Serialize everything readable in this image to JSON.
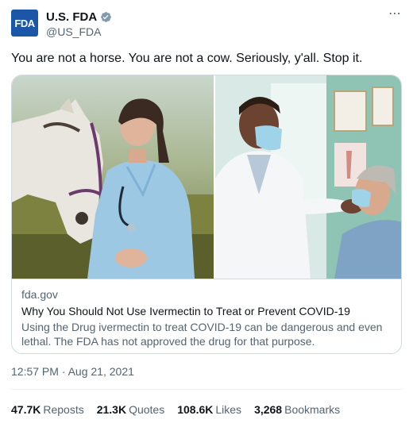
{
  "author": {
    "avatar_text": "FDA",
    "display_name": "U.S. FDA",
    "handle": "@US_FDA",
    "verified_icon": "verified-badge-icon",
    "avatar_color": "#1b57a6"
  },
  "more_icon": "⋯",
  "tweet": {
    "text": "You are not a horse. You are not a cow. Seriously, y'all. Stop it."
  },
  "card": {
    "domain": "fda.gov",
    "title": "Why You Should Not Use Ivermectin to Treat or Prevent COVID-19",
    "description": "Using the Drug ivermectin to treat COVID-19 can be dangerous and even lethal. The FDA has not approved the drug for that purpose."
  },
  "timestamp": "12:57 PM · Aug 21, 2021",
  "stats": {
    "reposts_value": "47.7K",
    "reposts_label": "Reposts",
    "quotes_value": "21.3K",
    "quotes_label": "Quotes",
    "likes_value": "108.6K",
    "likes_label": "Likes",
    "bookmarks_value": "3,268",
    "bookmarks_label": "Bookmarks"
  },
  "colors": {
    "text_primary": "#0f1419",
    "text_secondary": "#536471",
    "border": "#cfd9de",
    "verified_badge": "#829aab"
  }
}
